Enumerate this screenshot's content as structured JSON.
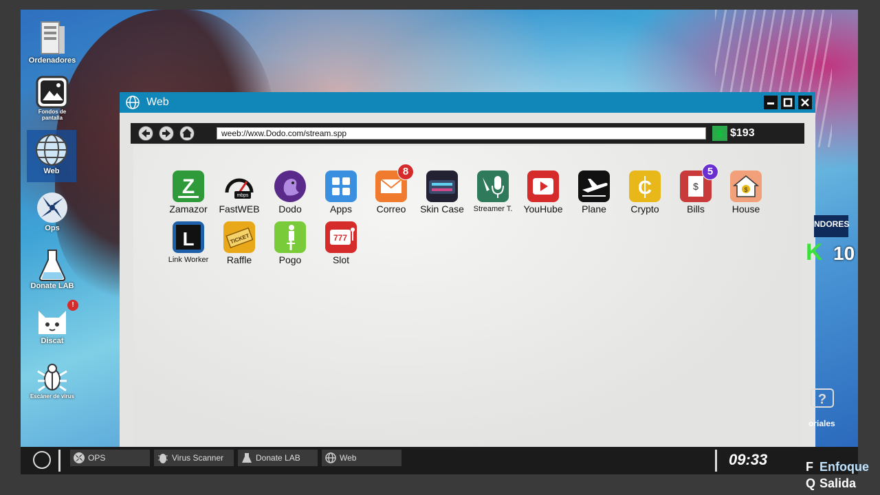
{
  "desktop": {
    "icons": [
      {
        "label": "Ordenadores",
        "icon": "computer-icon"
      },
      {
        "label": "Fondos de pantalla",
        "icon": "image-icon"
      },
      {
        "label": "Web",
        "icon": "globe-icon"
      },
      {
        "label": "Ops",
        "icon": "ops-icon"
      },
      {
        "label": "Donate LAB",
        "icon": "flask-icon"
      },
      {
        "label": "Discat",
        "icon": "cat-icon",
        "badge": "!"
      },
      {
        "label": "Escáner de virus",
        "icon": "bug-icon"
      }
    ]
  },
  "window": {
    "title": "Web",
    "url": "weeb://wxw.Dodo.com/stream.spp",
    "money": "$193",
    "apps": [
      {
        "label": "Zamazor",
        "icon": "zamazor-icon",
        "color": "#2e9a3a"
      },
      {
        "label": "FastWEB",
        "icon": "speedometer-icon",
        "color": "#ffffff"
      },
      {
        "label": "Dodo",
        "icon": "dodo-icon",
        "color": "#5a2a8a"
      },
      {
        "label": "Apps",
        "icon": "apps-grid-icon",
        "color": "#3b8fe0"
      },
      {
        "label": "Correo",
        "icon": "mail-icon",
        "color": "#f07a2e",
        "badge": "8",
        "badge_color": "#d62b2b"
      },
      {
        "label": "Skin Case",
        "icon": "skin-case-icon",
        "color": "#223"
      },
      {
        "label": "Streamer T.",
        "icon": "microphone-icon",
        "color": "#2e7a5a"
      },
      {
        "label": "YouHube",
        "icon": "play-icon",
        "color": "#d62b2b"
      },
      {
        "label": "Plane",
        "icon": "plane-icon",
        "color": "#111111"
      },
      {
        "label": "Crypto",
        "icon": "crypto-icon",
        "color": "#e8b81a"
      },
      {
        "label": "Bills",
        "icon": "bills-icon",
        "color": "#c93a3a",
        "badge": "5",
        "badge_color": "#6a2fd0"
      },
      {
        "label": "House",
        "icon": "house-icon",
        "color": "#f2a07a"
      },
      {
        "label": "Link Worker",
        "icon": "link-worker-icon",
        "color": "#1d5fa8"
      },
      {
        "label": "Raffle",
        "icon": "ticket-icon",
        "color": "#e8a81a"
      },
      {
        "label": "Pogo",
        "icon": "pogo-icon",
        "color": "#7acb3a"
      },
      {
        "label": "Slot",
        "icon": "slot-icon",
        "color": "#d62b2b"
      }
    ]
  },
  "right_widgets": {
    "vendor_label": "NDORES",
    "k_value": "10",
    "tutorial_label": "oriales"
  },
  "taskbar": {
    "tasks": [
      {
        "label": "OPS",
        "icon": "ops-icon"
      },
      {
        "label": "Virus Scanner",
        "icon": "bug-icon"
      },
      {
        "label": "Donate LAB",
        "icon": "flask-icon"
      },
      {
        "label": "Web",
        "icon": "globe-icon"
      }
    ],
    "clock": "09:33"
  },
  "hints": [
    {
      "key": "F",
      "label": "Enfoque"
    },
    {
      "key": "Q",
      "label": "Salida"
    }
  ]
}
